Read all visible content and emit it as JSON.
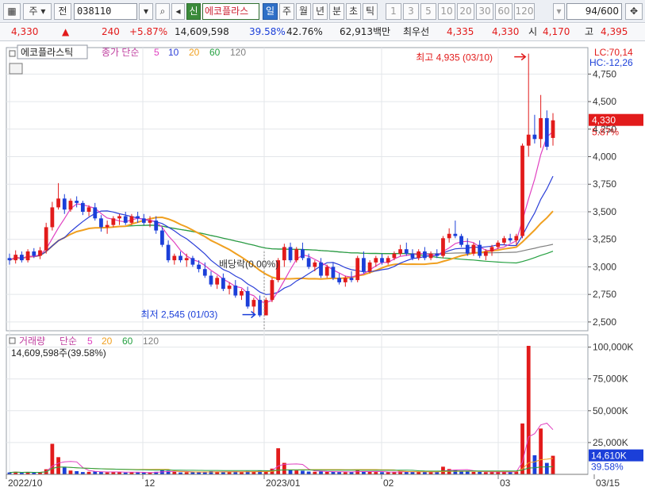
{
  "toolbar": {
    "type_label": "주",
    "prev_label": "전",
    "code": "038110",
    "market_badge": "신",
    "stock_name": "에코플라스",
    "periods": [
      "일",
      "주",
      "월",
      "년",
      "분",
      "초",
      "틱"
    ],
    "active_period": "일",
    "intervals": [
      "1",
      "3",
      "5",
      "10",
      "20",
      "30",
      "60",
      "120"
    ],
    "count": "94/600",
    "icons": [
      "grid-icon",
      "search-icon",
      "speaker-icon",
      "pin-icon"
    ]
  },
  "quote": {
    "price": "4,330",
    "arrow": "▲",
    "change": "240",
    "change_pct": "+5.87%",
    "volume": "14,609,598",
    "vol_ratio": "39.58%",
    "turnover": "42.76%",
    "amount": "62,913백만",
    "best_ask_label": "최우선",
    "ask": "4,335",
    "bid": "4,330",
    "open_label": "시",
    "open": "4,170",
    "high_label": "고",
    "high": "4,395"
  },
  "price_panel": {
    "name": "에코플라스틱",
    "ma_label": "종가 단순",
    "ma_periods": [
      "5",
      "10",
      "20",
      "60",
      "120"
    ],
    "ma_colors": [
      "#e040c0",
      "#2b3fd8",
      "#f0a020",
      "#24a040",
      "#808080"
    ],
    "lc": "LC:70,14",
    "hc": "HC:-12,26",
    "current_price": "4,330",
    "current_pct": "5.87%",
    "high_annotation": "최고 4,935 (03/10)",
    "low_annotation": "최저 2,545 (01/03)",
    "dividend_annotation": "배당락(0.00%)"
  },
  "volume_panel": {
    "label": "거래량",
    "ma_label": "단순",
    "ma_periods": [
      "5",
      "20",
      "60",
      "120"
    ],
    "info": "14,609,598주(39.58%)",
    "current_volume": "14,610K",
    "current_pct": "39.58%"
  },
  "x_axis": {
    "labels": [
      "2022/10",
      "12",
      "2023/01",
      "02",
      "03",
      "03/15"
    ]
  },
  "colors": {
    "up": "#e21b1b",
    "down": "#1b3fd9",
    "accent": "#e21b1b"
  },
  "chart_data": {
    "type": "candlestick",
    "price_ticks": [
      2500,
      2750,
      3000,
      3250,
      3500,
      3750,
      4000,
      4250,
      4500,
      4750
    ],
    "volume_ticks": [
      "25,000K",
      "50,000K",
      "75,000K",
      "100,000K"
    ],
    "candles": [
      [
        3080,
        3120,
        3020,
        3060
      ],
      [
        3060,
        3150,
        3030,
        3110
      ],
      [
        3110,
        3140,
        3040,
        3060
      ],
      [
        3060,
        3160,
        3040,
        3140
      ],
      [
        3140,
        3170,
        3080,
        3100
      ],
      [
        3100,
        3180,
        3070,
        3150
      ],
      [
        3150,
        3400,
        3120,
        3360
      ],
      [
        3360,
        3590,
        3330,
        3540
      ],
      [
        3540,
        3760,
        3520,
        3620
      ],
      [
        3620,
        3660,
        3480,
        3520
      ],
      [
        3520,
        3620,
        3500,
        3600
      ],
      [
        3600,
        3640,
        3540,
        3580
      ],
      [
        3580,
        3600,
        3470,
        3500
      ],
      [
        3500,
        3560,
        3460,
        3540
      ],
      [
        3540,
        3580,
        3420,
        3440
      ],
      [
        3440,
        3470,
        3320,
        3360
      ],
      [
        3360,
        3420,
        3300,
        3380
      ],
      [
        3380,
        3460,
        3360,
        3440
      ],
      [
        3440,
        3480,
        3380,
        3460
      ],
      [
        3460,
        3500,
        3380,
        3400
      ],
      [
        3400,
        3480,
        3380,
        3460
      ],
      [
        3460,
        3500,
        3400,
        3440
      ],
      [
        3440,
        3480,
        3380,
        3400
      ],
      [
        3400,
        3460,
        3360,
        3420
      ],
      [
        3420,
        3460,
        3300,
        3330
      ],
      [
        3330,
        3360,
        3180,
        3200
      ],
      [
        3200,
        3240,
        3040,
        3060
      ],
      [
        3060,
        3120,
        3020,
        3100
      ],
      [
        3100,
        3140,
        3040,
        3060
      ],
      [
        3060,
        3120,
        3000,
        3080
      ],
      [
        3080,
        3100,
        3000,
        3020
      ],
      [
        3020,
        3060,
        2950,
        2980
      ],
      [
        2980,
        3040,
        2900,
        2920
      ],
      [
        2920,
        2960,
        2820,
        2840
      ],
      [
        2840,
        2920,
        2800,
        2900
      ],
      [
        2900,
        2940,
        2780,
        2800
      ],
      [
        2800,
        2860,
        2750,
        2830
      ],
      [
        2830,
        2880,
        2720,
        2740
      ],
      [
        2740,
        2800,
        2700,
        2780
      ],
      [
        2780,
        2820,
        2620,
        2640
      ],
      [
        2640,
        2720,
        2580,
        2700
      ],
      [
        2700,
        2740,
        2545,
        2560
      ],
      [
        2560,
        2720,
        2560,
        2700
      ],
      [
        2700,
        2900,
        2680,
        2880
      ],
      [
        2880,
        3080,
        2860,
        3060
      ],
      [
        3060,
        3210,
        3000,
        3180
      ],
      [
        3180,
        3220,
        3040,
        3060
      ],
      [
        3060,
        3180,
        3040,
        3160
      ],
      [
        3160,
        3220,
        3060,
        3080
      ],
      [
        3080,
        3120,
        2980,
        3000
      ],
      [
        3000,
        3060,
        2960,
        3040
      ],
      [
        3040,
        3080,
        2900,
        2920
      ],
      [
        2920,
        3020,
        2900,
        3000
      ],
      [
        3000,
        3040,
        2880,
        2900
      ],
      [
        2900,
        2940,
        2840,
        2860
      ],
      [
        2860,
        2920,
        2820,
        2900
      ],
      [
        2900,
        2960,
        2860,
        2880
      ],
      [
        2880,
        3100,
        2860,
        3080
      ],
      [
        3080,
        3140,
        2940,
        2960
      ],
      [
        2960,
        3060,
        2940,
        3040
      ],
      [
        3040,
        3100,
        3000,
        3080
      ],
      [
        3080,
        3120,
        3020,
        3040
      ],
      [
        3040,
        3100,
        3020,
        3080
      ],
      [
        3080,
        3140,
        3060,
        3120
      ],
      [
        3120,
        3200,
        3100,
        3160
      ],
      [
        3160,
        3220,
        3100,
        3120
      ],
      [
        3120,
        3160,
        3060,
        3080
      ],
      [
        3080,
        3160,
        3060,
        3140
      ],
      [
        3140,
        3180,
        3060,
        3080
      ],
      [
        3080,
        3140,
        3060,
        3120
      ],
      [
        3120,
        3160,
        3080,
        3100
      ],
      [
        3100,
        3280,
        3080,
        3260
      ],
      [
        3260,
        3350,
        3220,
        3300
      ],
      [
        3300,
        3420,
        3260,
        3280
      ],
      [
        3280,
        3300,
        3180,
        3200
      ],
      [
        3200,
        3260,
        3100,
        3120
      ],
      [
        3120,
        3220,
        3100,
        3200
      ],
      [
        3200,
        3240,
        3080,
        3100
      ],
      [
        3100,
        3160,
        3060,
        3140
      ],
      [
        3140,
        3200,
        3100,
        3180
      ],
      [
        3180,
        3240,
        3160,
        3220
      ],
      [
        3220,
        3280,
        3200,
        3260
      ],
      [
        3260,
        3300,
        3220,
        3240
      ],
      [
        3240,
        3300,
        3200,
        3280
      ],
      [
        3280,
        4120,
        3260,
        4100
      ],
      [
        4100,
        4935,
        4000,
        4200
      ],
      [
        4200,
        4380,
        4120,
        4160
      ],
      [
        4160,
        4560,
        4080,
        4350
      ],
      [
        4350,
        4420,
        4060,
        4090
      ],
      [
        4170,
        4395,
        4100,
        4330
      ]
    ],
    "volumes": [
      1.5,
      2.0,
      1.2,
      1.8,
      1.3,
      1.6,
      4.0,
      24.0,
      13.5,
      6.0,
      3.0,
      2.5,
      1.8,
      2.0,
      2.2,
      1.9,
      1.5,
      1.8,
      2.0,
      1.4,
      1.6,
      1.5,
      1.3,
      1.4,
      2.0,
      3.5,
      2.8,
      1.9,
      1.5,
      1.6,
      1.8,
      1.6,
      2.2,
      2.5,
      1.8,
      2.1,
      1.9,
      2.4,
      1.7,
      2.6,
      2.2,
      3.0,
      2.4,
      4.5,
      20.5,
      9.0,
      3.8,
      3.0,
      2.8,
      2.2,
      2.0,
      2.4,
      1.9,
      2.1,
      1.8,
      1.7,
      2.0,
      3.0,
      2.4,
      1.9,
      1.8,
      1.7,
      1.6,
      2.0,
      2.4,
      2.2,
      1.8,
      2.0,
      1.9,
      1.7,
      1.8,
      6.0,
      4.2,
      3.5,
      2.4,
      2.2,
      1.9,
      2.0,
      1.7,
      1.8,
      1.9,
      2.0,
      1.8,
      2.2,
      40.0,
      101.0,
      15.0,
      36.0,
      9.0,
      14.6
    ]
  }
}
